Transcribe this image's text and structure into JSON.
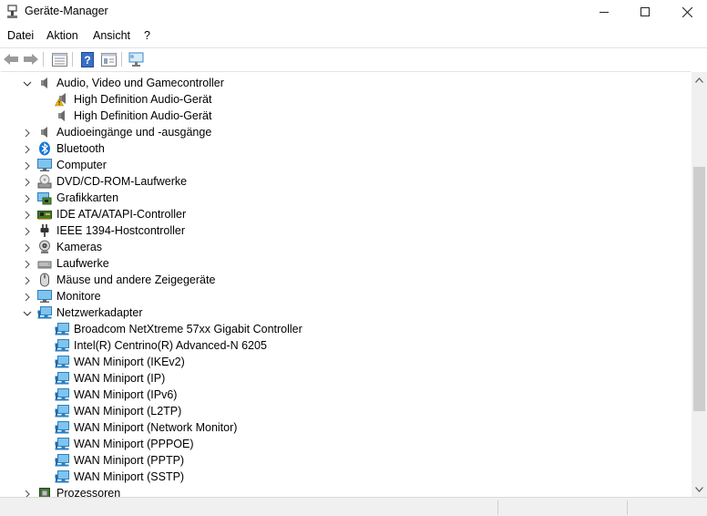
{
  "window": {
    "title": "Geräte-Manager",
    "icons": {
      "app": "device-manager-icon",
      "minimize": "minimize-icon",
      "maximize": "maximize-icon",
      "close": "close-icon"
    }
  },
  "menu": [
    "Datei",
    "Aktion",
    "Ansicht",
    "?"
  ],
  "toolbar": [
    "back-arrow-icon",
    "forward-arrow-icon",
    "properties-icon",
    "help-icon",
    "details-icon",
    "monitor-scan-icon"
  ],
  "tree": [
    {
      "label": "Audio, Video und Gamecontroller",
      "expanded": true,
      "level": 0,
      "icon": "speaker-icon"
    },
    {
      "label": "High Definition Audio-Gerät",
      "level": 1,
      "icon": "speaker-warning-icon"
    },
    {
      "label": "High Definition Audio-Gerät",
      "level": 1,
      "icon": "speaker-icon"
    },
    {
      "label": "Audioeingänge und -ausgänge",
      "expanded": false,
      "level": 0,
      "icon": "speaker-icon"
    },
    {
      "label": "Bluetooth",
      "expanded": false,
      "level": 0,
      "icon": "bluetooth-icon"
    },
    {
      "label": "Computer",
      "expanded": false,
      "level": 0,
      "icon": "monitor-icon"
    },
    {
      "label": "DVD/CD-ROM-Laufwerke",
      "expanded": false,
      "level": 0,
      "icon": "disc-drive-icon"
    },
    {
      "label": "Grafikkarten",
      "expanded": false,
      "level": 0,
      "icon": "display-adapter-icon"
    },
    {
      "label": "IDE ATA/ATAPI-Controller",
      "expanded": false,
      "level": 0,
      "icon": "ide-controller-icon"
    },
    {
      "label": "IEEE 1394-Hostcontroller",
      "expanded": false,
      "level": 0,
      "icon": "plug-icon"
    },
    {
      "label": "Kameras",
      "expanded": false,
      "level": 0,
      "icon": "camera-icon"
    },
    {
      "label": "Laufwerke",
      "expanded": false,
      "level": 0,
      "icon": "disk-drive-icon"
    },
    {
      "label": "Mäuse und andere Zeigegeräte",
      "expanded": false,
      "level": 0,
      "icon": "mouse-icon"
    },
    {
      "label": "Monitore",
      "expanded": false,
      "level": 0,
      "icon": "monitor-icon"
    },
    {
      "label": "Netzwerkadapter",
      "expanded": true,
      "level": 0,
      "icon": "network-adapter-icon"
    },
    {
      "label": "Broadcom NetXtreme 57xx Gigabit Controller",
      "level": 1,
      "icon": "network-adapter-icon"
    },
    {
      "label": "Intel(R) Centrino(R) Advanced-N 6205",
      "level": 1,
      "icon": "network-adapter-icon"
    },
    {
      "label": "WAN Miniport (IKEv2)",
      "level": 1,
      "icon": "network-adapter-icon"
    },
    {
      "label": "WAN Miniport (IP)",
      "level": 1,
      "icon": "network-adapter-icon"
    },
    {
      "label": "WAN Miniport (IPv6)",
      "level": 1,
      "icon": "network-adapter-icon"
    },
    {
      "label": "WAN Miniport (L2TP)",
      "level": 1,
      "icon": "network-adapter-icon"
    },
    {
      "label": "WAN Miniport (Network Monitor)",
      "level": 1,
      "icon": "network-adapter-icon"
    },
    {
      "label": "WAN Miniport (PPPOE)",
      "level": 1,
      "icon": "network-adapter-icon"
    },
    {
      "label": "WAN Miniport (PPTP)",
      "level": 1,
      "icon": "network-adapter-icon"
    },
    {
      "label": "WAN Miniport (SSTP)",
      "level": 1,
      "icon": "network-adapter-icon"
    },
    {
      "label": "Prozessoren",
      "expanded": false,
      "level": 0,
      "icon": "processor-icon"
    }
  ],
  "colors": {
    "scrollbar_thumb": "#cdcdcd",
    "statusbar": "#f0f0f0",
    "icon_blue": "#1e88d8",
    "warning": "#f2b90c"
  }
}
